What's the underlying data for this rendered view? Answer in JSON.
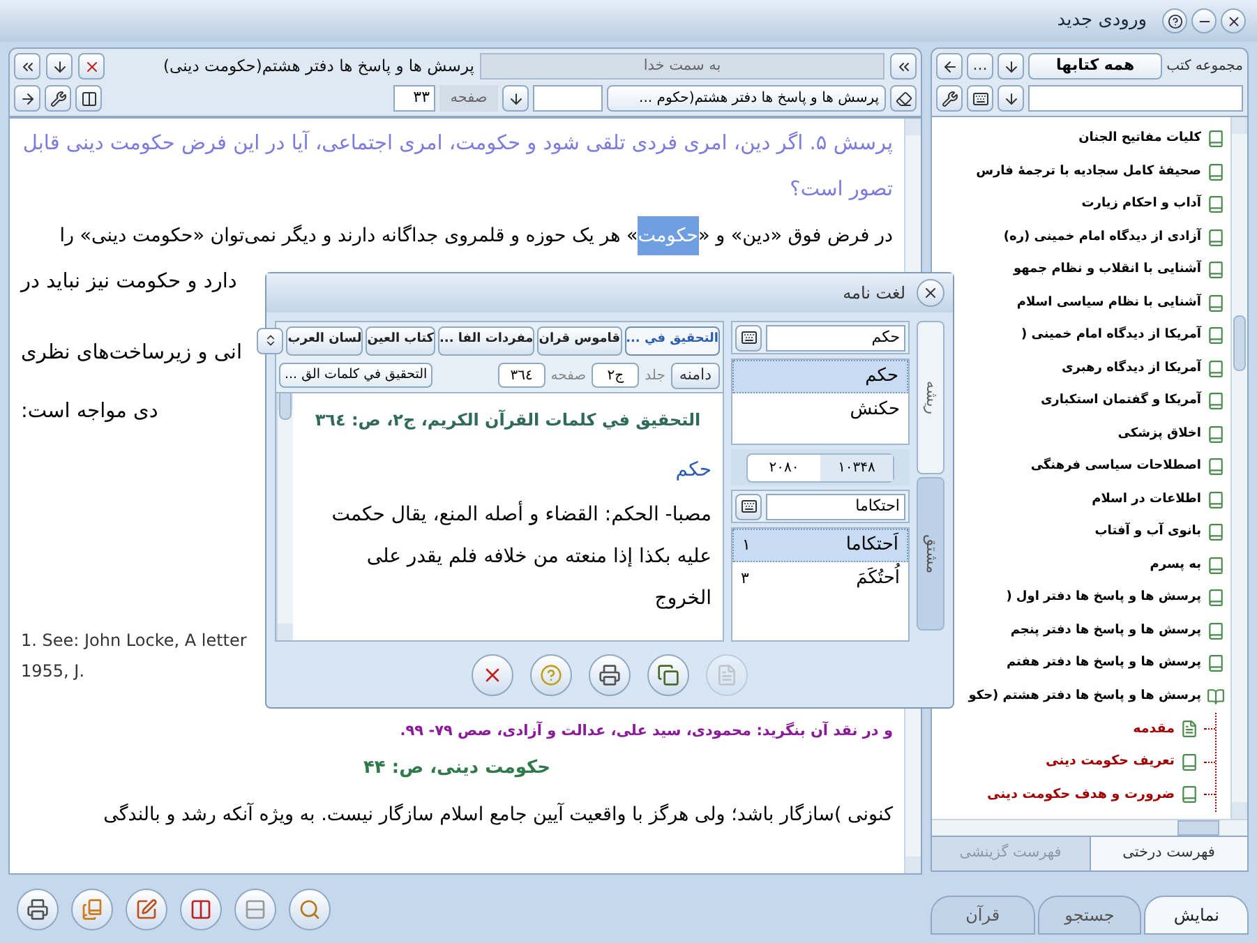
{
  "window": {
    "title": "ورودی جدید"
  },
  "reader": {
    "title": "پرسش ها و پاسخ ها دفتر هشتم(حکومت دینی)",
    "path": "به سمت خدا",
    "book_select": "پرسش ها و پاسخ ها دفتر هشتم(حکوم ...",
    "page_label": "صفحه",
    "page_value": "۳۳",
    "question": "پرسش ۵. اگر دین، امری فردی تلقی شود و حکومت، امری اجتماعی، آیا در این فرض حکومت دینی قابل تصور است؟",
    "paragraph": [
      {
        "text": "در فرض فوق «دین» و «",
        "selected": false
      },
      {
        "text": "حکومت",
        "selected": true
      },
      {
        "text": "» هر یک حوزه و قلمروی جداگانه دارند و دیگر نمی‌توان «حکومت دینی» را",
        "selected": false
      }
    ],
    "fragments": [
      "دارد و حکومت نیز نباید در",
      "انی و زیرساخت‌های نظری",
      "دی مواجه است:"
    ],
    "footnotes": [
      "1. See: John Locke, A letter",
      "1955, J."
    ],
    "reference": "و در نقد آن بنگرید: محمودی، سید علی، عدالت و آزادی، صص ۷۹- ۹۹.",
    "page_mark": "حکومت دینی، ص: ۴۴",
    "body": "کنونی )سازگار باشد؛ ولی هرگز با واقعیت آیین جامع اسلام سازگار نیست. به ویژه آنکه رشد و بالندگی"
  },
  "toolbar": [
    {
      "kind": "print"
    },
    {
      "kind": "books"
    },
    {
      "kind": "notes"
    },
    {
      "kind": "split"
    },
    {
      "kind": "layout"
    },
    {
      "kind": "search"
    }
  ],
  "library": {
    "label": "مجموعه کتب",
    "collection": "همه کتابها",
    "more": "...",
    "tree": [
      {
        "label": "کلیات مفاتیح الجنان",
        "expanded": false
      },
      {
        "label": "صحیفهٔ کامل سجادیه با ترجمهٔ فارس",
        "expanded": false
      },
      {
        "label": "آداب و احکام زیارت",
        "expanded": false
      },
      {
        "label": "آزادی از دیدگاه امام خمینی (ره)",
        "expanded": false
      },
      {
        "label": "آشنایی با انقلاب و نظام جمهو",
        "expanded": false
      },
      {
        "label": "آشنایی با نظام سیاسی اسلام",
        "expanded": false
      },
      {
        "label": "آمریکا از دیدگاه امام خمینی (",
        "expanded": false
      },
      {
        "label": "آمریکا از دیدگاه رهبری",
        "expanded": false
      },
      {
        "label": "آمریکا و گفتمان استکباری",
        "expanded": false
      },
      {
        "label": "اخلاق پزشکی",
        "expanded": false
      },
      {
        "label": "اصطلاحات سیاسی فرهنگی",
        "expanded": false
      },
      {
        "label": "اطلاعات در اسلام",
        "expanded": false
      },
      {
        "label": "بانوی آب و آفتاب",
        "expanded": false
      },
      {
        "label": "به پسرم",
        "expanded": false
      },
      {
        "label": "پرسش ها و پاسخ ها دفتر اول (",
        "expanded": false
      },
      {
        "label": "پرسش ها و پاسخ ها دفتر پنجم",
        "expanded": false
      },
      {
        "label": "پرسش ها و پاسخ ها دفتر هفتم",
        "expanded": false
      },
      {
        "label": "پرسش ها و پاسخ ها دفتر هشتم (حکو",
        "expanded": true,
        "children": [
          {
            "label": "مقدمه",
            "kind": "page"
          },
          {
            "label": "تعریف حکومت دینی",
            "kind": "book"
          },
          {
            "label": "ضرورت و هدف حکومت دینی",
            "kind": "book"
          }
        ]
      }
    ],
    "tabs": [
      {
        "label": "فهرست درختی",
        "selected": true
      },
      {
        "label": "فهرست گزینشی",
        "selected": false
      }
    ]
  },
  "main_tabs": [
    {
      "label": "نمایش",
      "selected": true
    },
    {
      "label": "جستجو",
      "selected": false
    },
    {
      "label": "قرآن",
      "selected": false
    }
  ],
  "dictionary": {
    "title": "لغت نامه",
    "side_tabs": [
      {
        "label": "ریشه",
        "selected": true
      },
      {
        "label": "مشتق",
        "selected": false
      }
    ],
    "root_search": "حکم",
    "roots": [
      {
        "text": "حکم",
        "selected": true
      },
      {
        "text": "حکنش",
        "selected": false
      }
    ],
    "counts": [
      "۱۰۳۴۸",
      "۲۰۸۰"
    ],
    "derived_search": "احتکاما",
    "derived": [
      {
        "text": "اَحتکاما",
        "count": "۱",
        "selected": true
      },
      {
        "text": "اُحتُکَمَ",
        "count": "۳",
        "selected": false
      }
    ],
    "sources": [
      {
        "label": "التحقیق في ...",
        "selected": true
      },
      {
        "label": "قاموس قران",
        "selected": false
      },
      {
        "label": "مفردات الفا ...",
        "selected": false
      },
      {
        "label": "کتاب العین",
        "selected": false
      },
      {
        "label": "لسان العرب",
        "selected": false
      }
    ],
    "scope": "دامنه",
    "volume_label": "جلد",
    "volume": "ج۲",
    "page_label": "صفحه",
    "page": "٣٦٤",
    "source_select": "التحقیق في کلمات الق ...",
    "heading": "التحقيق في كلمات القرآن الكريم، ج٢، ص: ٣٦٤",
    "entry": "حكم",
    "body": "مصبا- الحكم: القضاء و أصله المنع، يقال حكمت عليه بكذا إذا منعته من خلافه فلم يقدر على الخروج",
    "actions": [
      {
        "kind": "note",
        "disabled": true
      },
      {
        "kind": "copy",
        "disabled": false
      },
      {
        "kind": "print",
        "disabled": false
      },
      {
        "kind": "help",
        "disabled": false
      },
      {
        "kind": "close",
        "disabled": false
      }
    ]
  }
}
